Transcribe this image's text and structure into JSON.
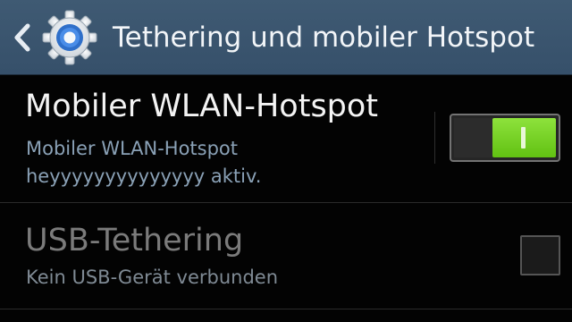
{
  "action_bar": {
    "title": "Tethering und mobiler Hotspot",
    "back_icon": "chevron-left-icon",
    "app_icon": "gear-icon",
    "background_color": "#3b566f"
  },
  "settings": {
    "hotspot": {
      "title": "Mobiler WLAN-Hotspot",
      "summary_line1": "Mobiler WLAN-Hotspot",
      "summary_line2": "heyyyyyyyyyyyyyy aktiv.",
      "switch_state": "on",
      "switch_color": "#7cd42a"
    },
    "usb_tethering": {
      "title": "USB-Tethering",
      "summary": "Kein USB-Gerät verbunden",
      "enabled": false,
      "checked": false
    }
  }
}
